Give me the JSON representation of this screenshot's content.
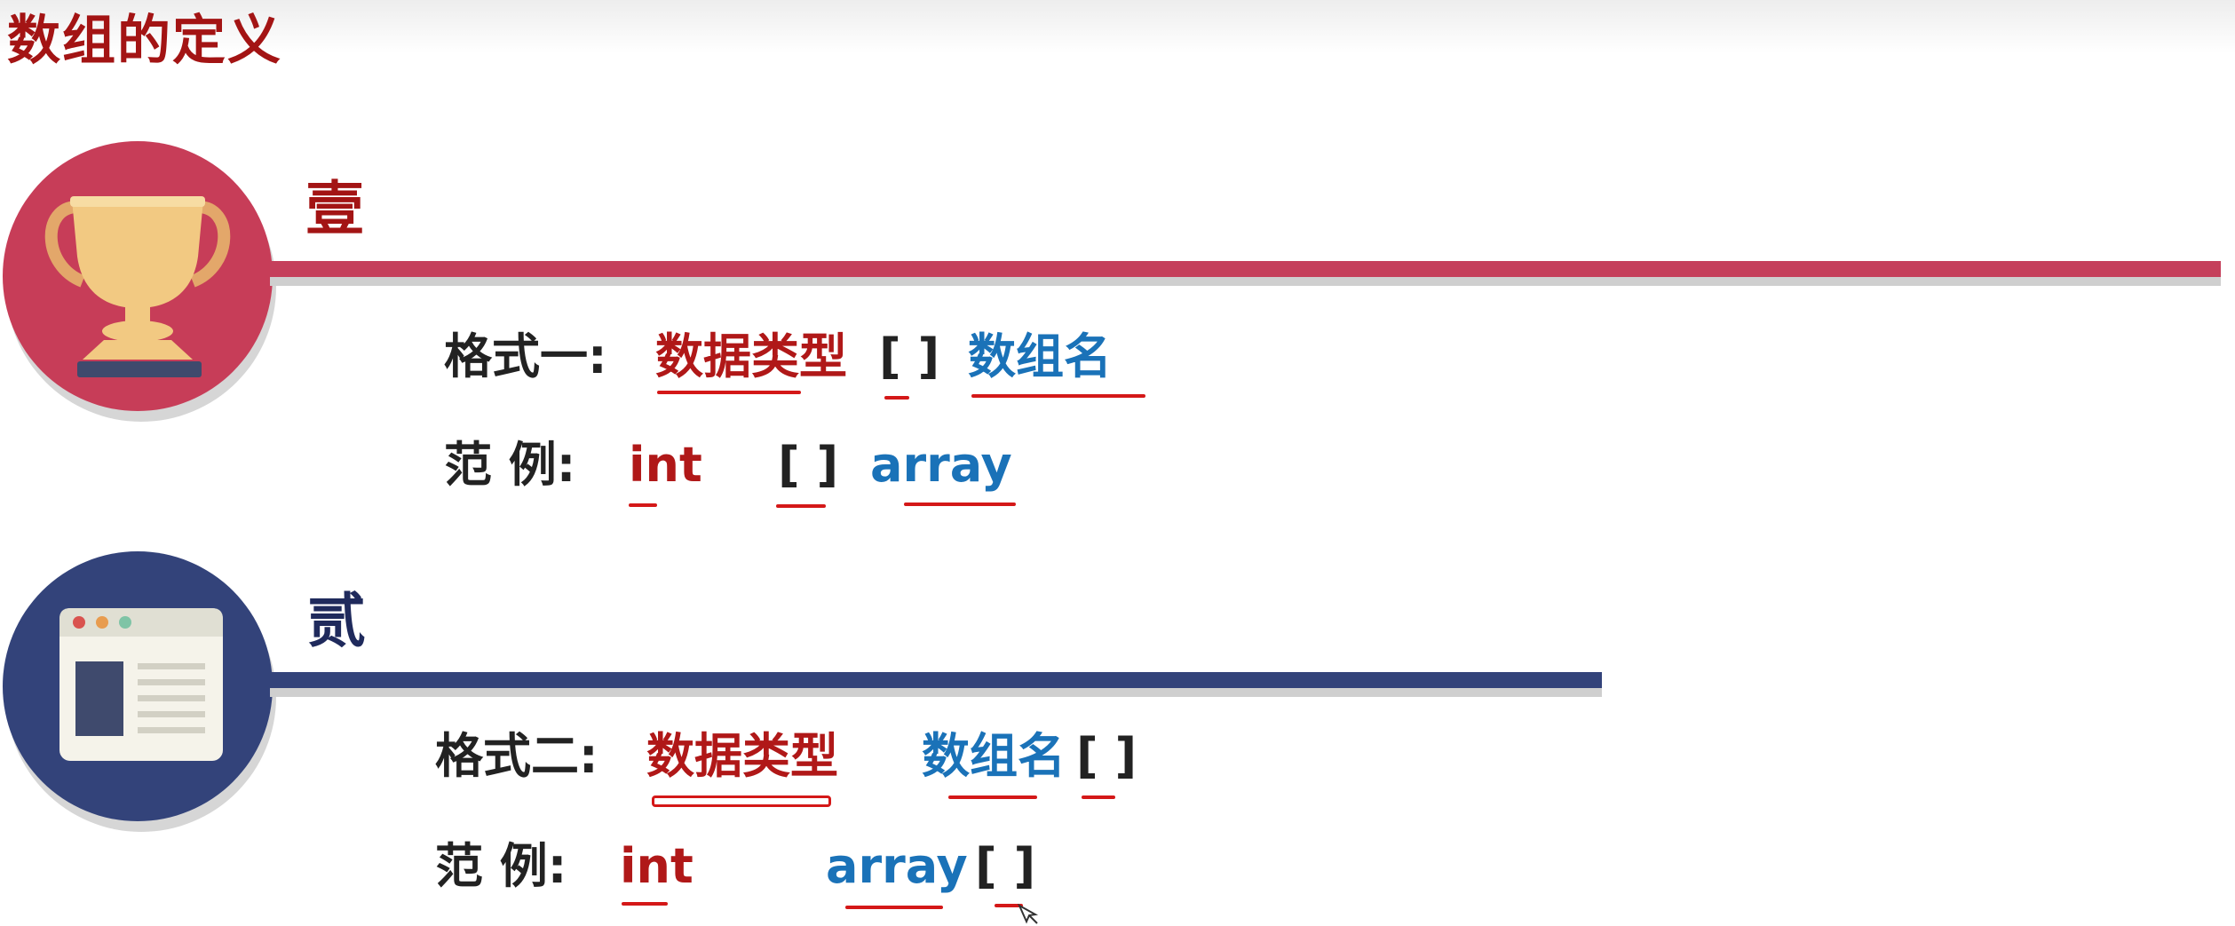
{
  "page": {
    "title": "数组的定义"
  },
  "section_one": {
    "number": "壹",
    "format_label": "格式一:",
    "format_type": "数据类型",
    "format_brackets": "[ ]",
    "format_name": "数组名",
    "example_label": "范 例:",
    "example_type": "int",
    "example_brackets": "[ ]",
    "example_name": "array",
    "icon": "trophy-icon",
    "color": "#c73d58"
  },
  "section_two": {
    "number": "贰",
    "format_label": "格式二:",
    "format_type": "数据类型",
    "format_name": "数组名",
    "format_brackets": "[ ]",
    "example_label": "范 例:",
    "example_type": "int",
    "example_name": "array",
    "example_brackets": "[ ]",
    "icon": "browser-window-icon",
    "color": "#33437a"
  },
  "colors": {
    "keyword": "#b01818",
    "identifier": "#1a72b8",
    "underline": "#d41818"
  }
}
